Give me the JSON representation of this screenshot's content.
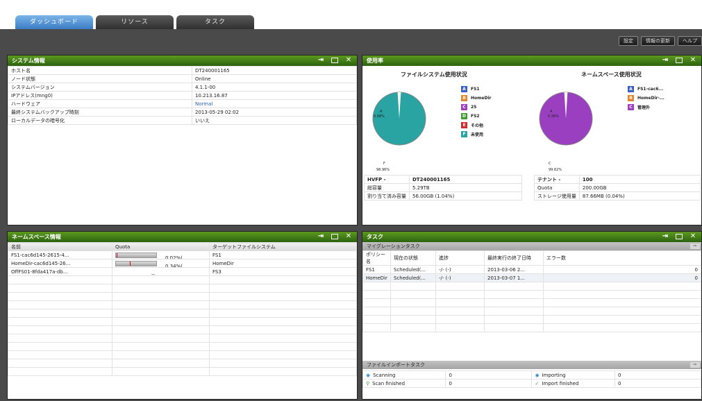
{
  "tabs": [
    "ダッシュボード",
    "リソース",
    "タスク"
  ],
  "toolbar": {
    "settings": "設定",
    "refresh": "情報の更新",
    "help": "ヘルプ"
  },
  "system_info": {
    "title": "システム情報",
    "rows": [
      [
        "ホスト名",
        "DT240001165"
      ],
      [
        "ノード状態",
        "Online"
      ],
      [
        "システムバージョン",
        "4.1.1-00"
      ],
      [
        "IPアドレス(mng0)",
        "10.213.16.87"
      ],
      [
        "ハードウェア",
        "Normal"
      ],
      [
        "最終システムバックアップ時刻",
        "2013-05-29 02:02"
      ],
      [
        "ローカルデータの暗号化",
        "いいえ"
      ]
    ]
  },
  "usage": {
    "title": "使用率",
    "fs_title": "ファイルシステム使用状況",
    "ns_title": "ネームスペース使用状況",
    "fs_legend": [
      {
        "letter": "A",
        "label": "FS1",
        "color": "#3b5fc8"
      },
      {
        "letter": "B",
        "label": "HomeDir",
        "color": "#e0852a"
      },
      {
        "letter": "C",
        "label": "25",
        "color": "#9a3fc0"
      },
      {
        "letter": "D",
        "label": "FS2",
        "color": "#3f9a2f"
      },
      {
        "letter": "E",
        "label": "その他",
        "color": "#d12a2a"
      },
      {
        "letter": "F",
        "label": "未使用",
        "color": "#2aa3a3"
      }
    ],
    "ns_legend": [
      {
        "letter": "A",
        "label": "FS1-cac6...",
        "color": "#3b5fc8"
      },
      {
        "letter": "B",
        "label": "HomeDir-...",
        "color": "#e0852a"
      },
      {
        "letter": "C",
        "label": "管理外",
        "color": "#9a3fc0"
      }
    ],
    "fs_pie": {
      "used_label": "0.98%",
      "free_label": "98.96%",
      "letter_a": "A",
      "letter_f": "F",
      "used_fraction": 0.0104,
      "color": "#2aa3a3"
    },
    "ns_pie": {
      "used_label": "0.36%",
      "free_label": "99.62%",
      "letter_a": "A",
      "letter_c": "C",
      "used_fraction": 0.004,
      "color": "#9a3fc0"
    },
    "fs_table": {
      "head1": "HVFP -",
      "head2": "DT240001165",
      "rows": [
        [
          "総容量",
          "5.29TB"
        ],
        [
          "割り当て済み容量",
          "56.00GB (1.04%)"
        ]
      ]
    },
    "ns_table": {
      "head1": "テナント -",
      "head2": "100",
      "rows": [
        [
          "Quota",
          "200.00GB"
        ],
        [
          "ストレージ使用量",
          "87.66MB (0.04%)"
        ]
      ]
    }
  },
  "namespace_info": {
    "title": "ネームスペース情報",
    "cols": [
      "名前",
      "Quota",
      "ターゲットファイルシステム"
    ],
    "rows": [
      {
        "name": "FS1-cac6d145-2615-4...",
        "quota": "0.02%(...",
        "quota_fill": 0.02,
        "target": "FS1"
      },
      {
        "name": "HomeDir-cac6d145-26...",
        "quota": "0.34%(...",
        "quota_fill": 0.34,
        "target": "HomeDir"
      },
      {
        "name": "OffFS01-8fda417a-db...",
        "quota": "--",
        "quota_fill": null,
        "target": "FS3"
      }
    ]
  },
  "tasks": {
    "title": "タスク",
    "migration_title": "マイグレーションタスク",
    "cols": [
      "ポリシー名",
      "現在の状態",
      "進捗",
      "最終実行の終了日時",
      "エラー数"
    ],
    "rows": [
      [
        "FS1",
        "Scheduled(...",
        "-/- (-)",
        "2013-03-06 2...",
        "0"
      ],
      [
        "HomeDir",
        "Scheduled(...",
        "-/- (-)",
        "2013-03-07 1...",
        "0"
      ]
    ],
    "import_title": "ファイルインポートタスク",
    "import_rows": [
      [
        {
          "icon": "scanning-icon",
          "label": "Scanning",
          "value": "0"
        },
        {
          "icon": "importing-icon",
          "label": "Importing",
          "value": "0"
        }
      ],
      [
        {
          "icon": "scan-finished-icon",
          "label": "Scan finished",
          "value": "0"
        },
        {
          "icon": "import-finished-icon",
          "label": "Import finished",
          "value": "0"
        }
      ]
    ]
  }
}
